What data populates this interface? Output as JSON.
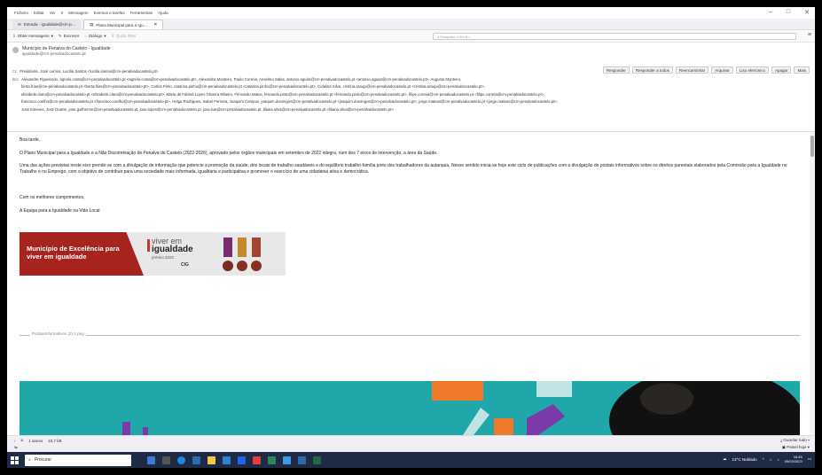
{
  "menubar": {
    "items": [
      "Ficheiro",
      "Editar",
      "Ver",
      "Ir",
      "Mensagem",
      "Eventos e tarefas",
      "Ferramentas",
      "Ajuda"
    ],
    "controls": [
      "–",
      "□",
      "✕"
    ]
  },
  "tabs": [
    {
      "label": "Entrada - igualdade@cm-p…",
      "active": false
    },
    {
      "label": "Plano Municipal para a Igu…",
      "active": true,
      "close": "✕"
    }
  ],
  "toolbar": {
    "get_messages": "Obter mensagens",
    "write": "Escrever",
    "chat": "Diálogo",
    "quick_filter": "Quick Filter",
    "search_placeholder": "Pesquisa <Ctrl+K>",
    "menu_icon": "≡"
  },
  "message": {
    "from_name": "Município de Penalva do Castelo - Igualdade",
    "from_email": "igualdade@cm-penalvadocastelo.pt",
    "actions": [
      "Responder",
      "Responder a todos",
      "Reencaminhar",
      "Arquivar",
      "Lixo eletrónico",
      "Apagar",
      "Mais"
    ],
    "cc_label": "Cc",
    "cc": "Presidente, José Lemos, Lucília Santos <lucilia.santos@cm-penalvadocastelo.pt>",
    "bcc_label": "Bcc",
    "bcc_lines": [
      "Alexandre Figueiredo, agnelo.costa@cm-penalvadocastelo.pt <agnelo.costa@cm-penalvadocastelo.pt>, Alexandra Monteiro, Paulo Correia, Anselmo Salas, antonio.aguiar@cm-penalvadocastelo.pt <antonio.aguiar@cm-penalvadocastelo.pt>, Augusto Monteiro,",
      "berta.frias@cm-penalvadocastelo.pt <berta.frias@cm-penalvadocastelo.pt>, Carlos Pinto, catarina.pinho@cm-penalvadocastelo.pt <catarina.pinho@cm-penalvadocastelo.pt>, Cidalina Silva, cristina.araujo@cm-penalvadocastelo.pt <cristina.araujo@cm-penalvadocastelo.pt>,",
      "elizabete.claro@cm-penalvadocastelo.pt <elizabete.claro@cm-penalvadocastelo.pt>, Maria de Fátima Lopes Oliveira Ribeiro, Fernando Matos, fernando.pinto@cm-penalvadocastelo.pt <fernando.pinto@cm-penalvadocastelo.pt>, filipe.correia@cm-penalvadocastelo.pt <filipe.correia@cm-penalvadocastelo.pt>,",
      "francisco.coelho@cm-penalvadocastelo.pt <francisco.coelho@cm-penalvadocastelo.pt>, Helga Rodrigues, Isabel Ferreira, Joaquim Campos, joaquim.domingos@cm-penalvadocastelo.pt <joaquim.domingos@cm-penalvadocastelo.pt>, jorge.mateus@cm-penalvadocastelo.pt <jorge.mateus@cm-penalvadocastelo.pt>,",
      "José Esteves, José Duarte, jose.guilherme@cm-penalvadocastelo.pt, jose.lopes@cm-penalvadocastelo.pt, jose.luis@cm-penalvadocastelo.pt, liliana.silva@cm-penalvadocastelo.pt <liliana.silva@cm-penalvadocastelo.pt>"
    ]
  },
  "body": {
    "greeting": "Boa tarde,",
    "p1": "O Plano Municipal para a Igualdade e a Não Discriminação de Penalva do Castelo (2022-2026), aprovado pelos órgãos municipais em setembro de 2022 integra, num dos 7 eixos de intervenção, a área da Saúde.",
    "p2": "Uma das ações previstas neste eixo prende-se com a divulgação de informação que potencie a promoção da saúde, dos locais de trabalho saudáveis e do equilíbrio trabalho-família junto dos trabalhadores da autarquia. Nesse sentido inicia-se hoje este ciclo de publicações com a divulgação de postais informativos sobre os direitos parentais elaborados pela Comissão para a Igualdade no Trabalho e no Emprego, com o objetivo de contribuir para uma sociedade mais informada, igualitária e participativa e promover o exercício de uma cidadania ativa e democrática.",
    "closing": "Com os melhores cumprimentos,",
    "signature": "A Equipa para a Igualdade na Vida Local",
    "banner_text": "Município de Excelência para viver em igualdade",
    "banner_logo_l1": "viver em",
    "banner_logo_l2": "igualdade",
    "banner_logo_l3": "prémio 2022",
    "banner_logo_l4": "CIG",
    "attachment_label": "PostaisInformativos (2)-1.png"
  },
  "status": {
    "attachments": "1 anexo",
    "size": "23,7 kB",
    "save_all": "Guardar tudo",
    "panel": "Painel hoje"
  },
  "taskbar": {
    "search_placeholder": "Procurar",
    "weather": "13°C Nublado",
    "time": "16:45",
    "date": "09/03/2023"
  }
}
